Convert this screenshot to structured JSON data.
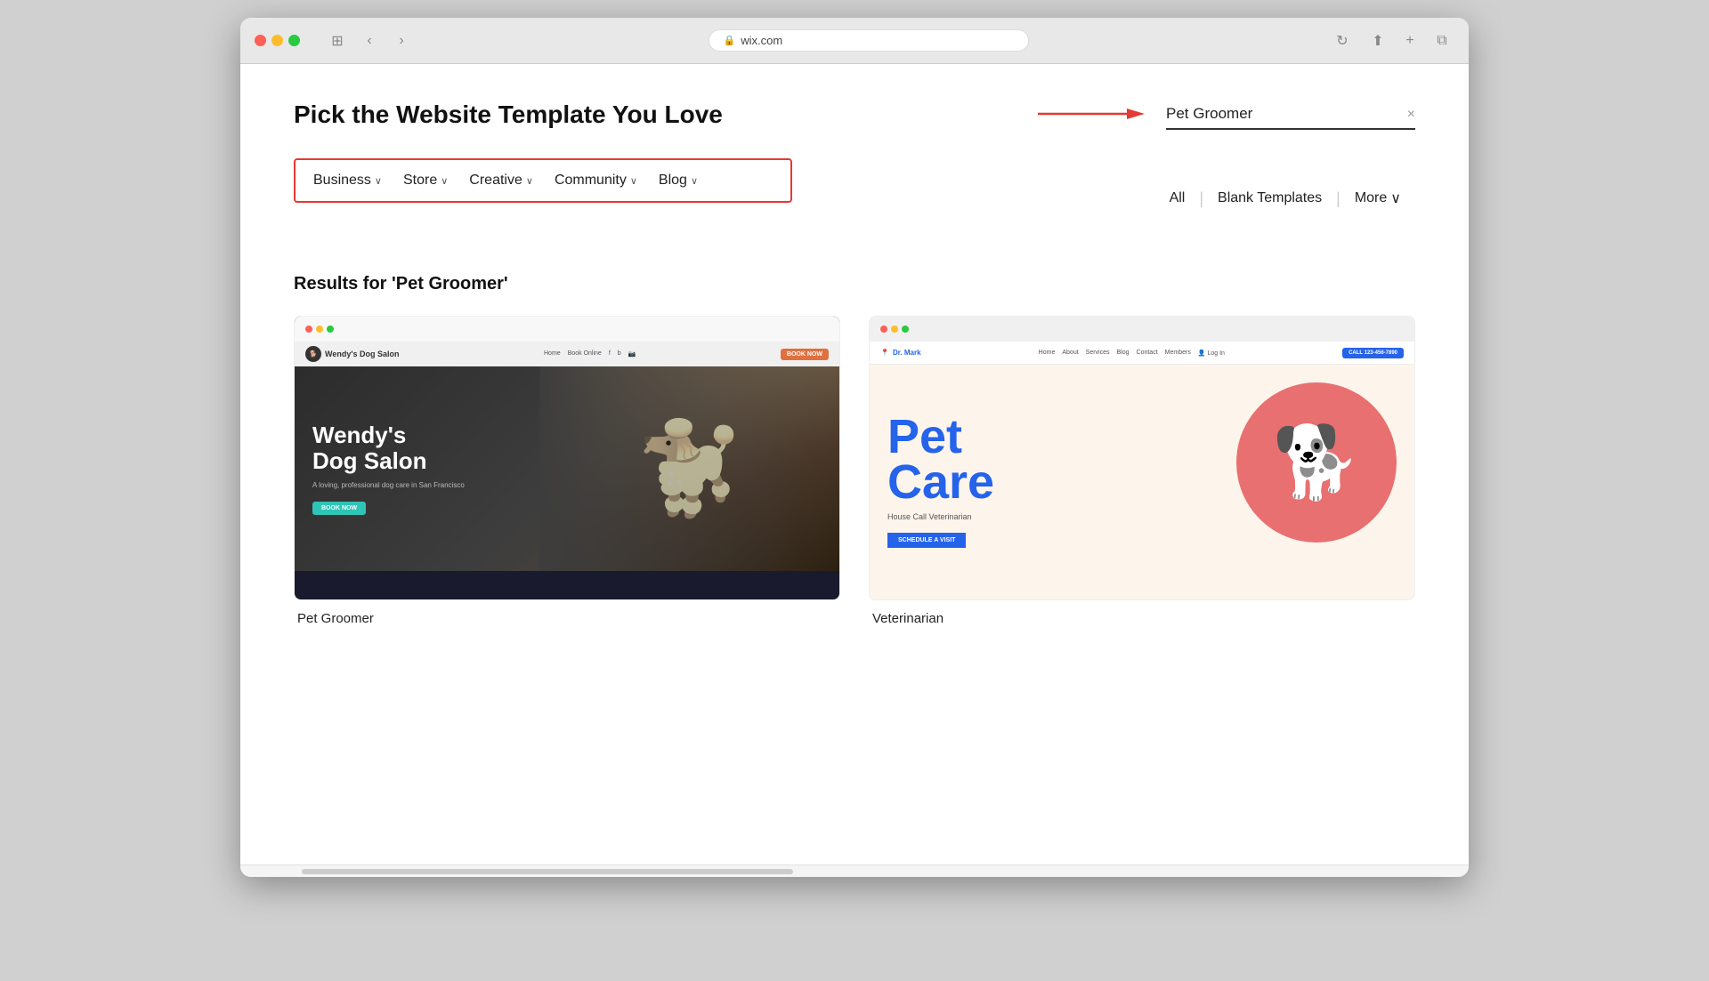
{
  "browser": {
    "url": "wix.com",
    "nav_back": "‹",
    "nav_forward": "›",
    "security_icon": "🔒",
    "refresh_icon": "↻",
    "share_icon": "⬆",
    "newtab_icon": "+",
    "tabs_icon": "⧉"
  },
  "page": {
    "title": "Pick the Website Template You Love",
    "search_placeholder": "Pet Groomer",
    "search_value": "Pet Groomer",
    "clear_icon": "×",
    "arrow_label": "→"
  },
  "nav": {
    "items": [
      {
        "label": "Business",
        "has_chevron": true
      },
      {
        "label": "Store",
        "has_chevron": true
      },
      {
        "label": "Creative",
        "has_chevron": true
      },
      {
        "label": "Community",
        "has_chevron": true
      },
      {
        "label": "Blog",
        "has_chevron": true
      }
    ]
  },
  "filters": {
    "all_label": "All",
    "blank_templates_label": "Blank Templates",
    "more_label": "More",
    "more_chevron": "∨"
  },
  "results": {
    "heading": "Results for 'Pet Groomer'",
    "templates": [
      {
        "name": "Pet Groomer",
        "mock_type": "wendys",
        "topbar_title": "Wendy's Dog Salon",
        "nav_links": [
          "Home",
          "Book Online",
          "f",
          "b",
          "g"
        ],
        "hero_title_line1": "Wendy's",
        "hero_title_line2": "Dog Salon",
        "hero_subtitle": "A loving, professional dog care in San Francisco",
        "hero_btn": "BOOK NOW",
        "book_now_btn": "BOOK NOW"
      },
      {
        "name": "Veterinarian",
        "mock_type": "petcare",
        "topbar_title": "Dr. Mark",
        "nav_links": [
          "Home",
          "About",
          "Services",
          "Blog",
          "Contact",
          "Members"
        ],
        "hero_title_line1": "Pet",
        "hero_title_line2": "Care",
        "hero_subtitle": "House Call Veterinarian",
        "schedule_btn": "SCHEDULE A VISIT",
        "call_btn": "CALL 123-456-7890",
        "login_label": "Log In"
      }
    ]
  }
}
